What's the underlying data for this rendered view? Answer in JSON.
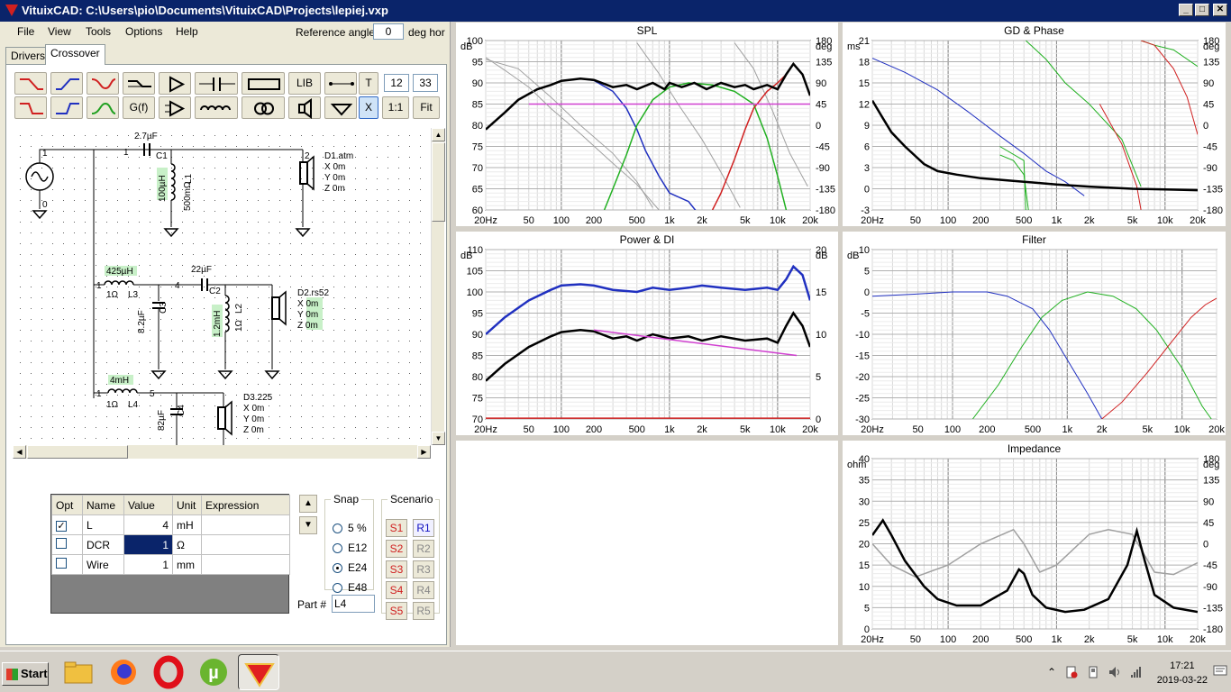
{
  "window": {
    "title": "VituixCAD: C:\\Users\\pio\\Documents\\VituixCAD\\Projects\\lepiej.vxp",
    "min": "_",
    "max": "□",
    "close": "✕"
  },
  "menu": [
    "File",
    "View",
    "Tools",
    "Options",
    "Help"
  ],
  "reference_angle": {
    "label": "Reference angle",
    "value": "0",
    "unit": "deg hor"
  },
  "tabs": [
    "Drivers",
    "Crossover"
  ],
  "toolbar": {
    "lib": "LIB",
    "t": "T",
    "x": "X",
    "one_to_one": "1:1",
    "fit": "Fit",
    "gf": "G(f)",
    "num1": "12",
    "num2": "33"
  },
  "schematic": {
    "labels": {
      "c1_val": "2.7µF",
      "c1": "C1",
      "l1_val": "100µH",
      "l1_dcr": "500mΩ",
      "l1": "L1",
      "d1": "D1.atm",
      "d1_x": "X 0m",
      "d1_y": "Y 0m",
      "d1_z": "Z 0m",
      "l3_val": "425µH",
      "l3_dcr": "1Ω",
      "l3": "L3",
      "c2_val": "22µF",
      "c2": "C2",
      "c3_val": "8.2µF",
      "c3": "C3",
      "l2_val": "1.2mH",
      "l2_dcr": "1Ω",
      "l2": "L2",
      "d2": "D2.rs52",
      "d2_x": "X 0m",
      "d2_y": "Y 0m",
      "d2_z": "Z 0m",
      "l4_val": "4mH",
      "l4_dcr": "1Ω",
      "l4": "L4",
      "c4_val": "82µF",
      "c4": "C4",
      "d3": "D3.225",
      "d3_x": "X 0m",
      "d3_y": "Y 0m",
      "d3_z": "Z 0m"
    }
  },
  "properties": {
    "headers": [
      "Opt",
      "Name",
      "Value",
      "Unit",
      "Expression"
    ],
    "rows": [
      {
        "checked": "✓",
        "name": "L",
        "value": "4",
        "unit": "mH",
        "expression": ""
      },
      {
        "checked": "",
        "name": "DCR",
        "value": "1",
        "unit": "Ω",
        "expression": ""
      },
      {
        "checked": "",
        "name": "Wire",
        "value": "1",
        "unit": "mm",
        "expression": ""
      }
    ]
  },
  "snap": {
    "label": "Snap",
    "options": [
      "5 %",
      "E12",
      "E24",
      "E48"
    ],
    "selected": "E24"
  },
  "scenario": {
    "label": "Scenario",
    "s": [
      "S1",
      "S2",
      "S3",
      "S4",
      "S5"
    ],
    "r": [
      "R1",
      "R2",
      "R3",
      "R4",
      "R5"
    ]
  },
  "part": {
    "label": "Part #",
    "value": "L4"
  },
  "charts": {
    "spl": {
      "title": "SPL",
      "yunit": "dB",
      "y2unit": "deg",
      "yticks": [
        "100",
        "95",
        "90",
        "85",
        "80",
        "75",
        "70",
        "65",
        "60"
      ],
      "y2ticks": [
        "180",
        "135",
        "90",
        "45",
        "0",
        "-45",
        "-90",
        "-135",
        "-180"
      ]
    },
    "gd": {
      "title": "GD & Phase",
      "yunit": "ms",
      "y2unit": "deg",
      "yticks": [
        "21",
        "18",
        "15",
        "12",
        "9",
        "6",
        "3",
        "0",
        "-3"
      ],
      "y2ticks": [
        "180",
        "135",
        "90",
        "45",
        "0",
        "-45",
        "-90",
        "-135",
        "-180"
      ]
    },
    "power": {
      "title": "Power & DI",
      "yunit": "dB",
      "y2unit": "dB",
      "yticks": [
        "110",
        "105",
        "100",
        "95",
        "90",
        "85",
        "80",
        "75",
        "70"
      ],
      "y2ticks": [
        "20",
        "15",
        "10",
        "5",
        "0"
      ]
    },
    "filter": {
      "title": "Filter",
      "yunit": "dB",
      "yticks": [
        "10",
        "5",
        "0",
        "-5",
        "-10",
        "-15",
        "-20",
        "-25",
        "-30"
      ]
    },
    "imp": {
      "title": "Impedance",
      "yunit": "ohm",
      "y2unit": "deg",
      "yticks": [
        "40",
        "35",
        "30",
        "25",
        "20",
        "15",
        "10",
        "5",
        "0"
      ],
      "y2ticks": [
        "180",
        "135",
        "90",
        "45",
        "0",
        "-45",
        "-90",
        "-135",
        "-180"
      ]
    },
    "xticks": [
      "20Hz",
      "50",
      "100",
      "200",
      "500",
      "1k",
      "2k",
      "5k",
      "10k",
      "20k"
    ],
    "colors": {
      "woofer": "#2030c0",
      "mid": "#20b020",
      "tweeter": "#d02020",
      "sum": "#000000",
      "ref": "#d040d0",
      "grey": "#a0a0a0"
    }
  },
  "taskbar": {
    "start": "Start",
    "time": "17:21",
    "date": "2019-03-22",
    "chevron": "⌃"
  }
}
